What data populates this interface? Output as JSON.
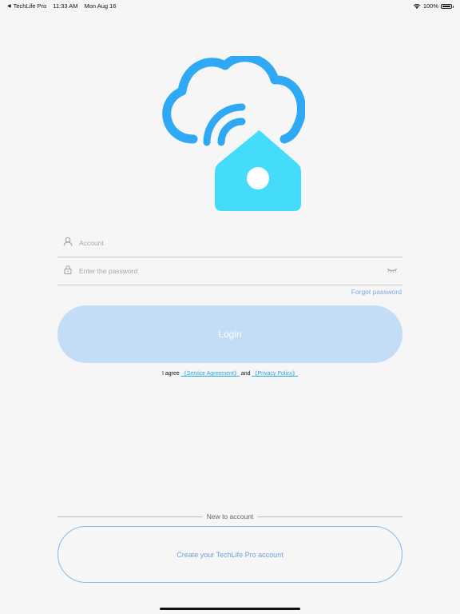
{
  "status_bar": {
    "back_app": "TechLife Pro",
    "time": "11:33 AM",
    "date": "Mon Aug 16",
    "battery": "100%"
  },
  "form": {
    "account_placeholder": "Account",
    "password_placeholder": "Enter the password",
    "forgot_password": "Forgot password",
    "login_label": "Login"
  },
  "agreement": {
    "prefix": "I agree",
    "service_link": "《Service Agreement》",
    "and": "and",
    "privacy_link": "《Privacy Policy》"
  },
  "signup": {
    "divider_text": "New to account",
    "create_label": "Create your TechLife Pro account"
  },
  "colors": {
    "accent_blue": "#2aa4e6",
    "login_button": "#c3ddf6",
    "outline_button": "#8fb6e8",
    "logo_cloud": "#2fa9f5",
    "logo_house": "#45dcfb"
  },
  "icons": [
    "back-arrow-icon",
    "wifi-icon",
    "battery-icon",
    "app-logo",
    "user-icon",
    "lock-icon",
    "eye-closed-icon"
  ]
}
